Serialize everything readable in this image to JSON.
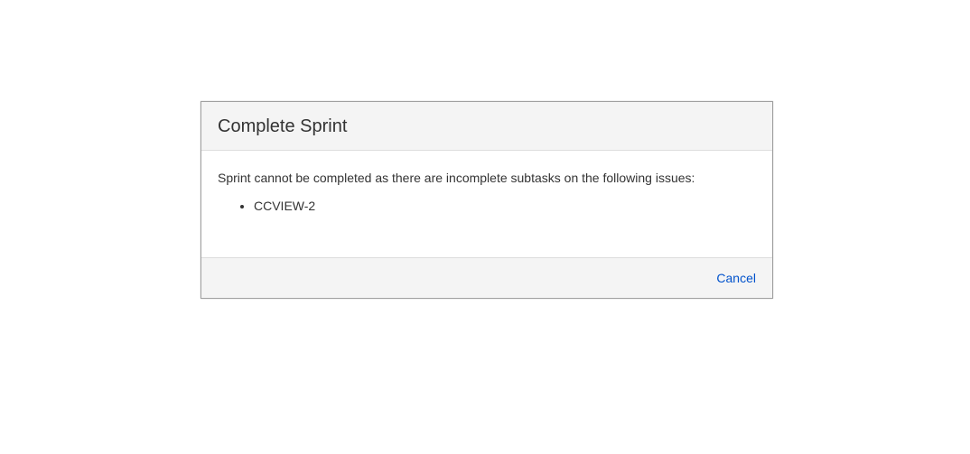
{
  "dialog": {
    "title": "Complete Sprint",
    "message": "Sprint cannot be completed as there are incomplete subtasks on the following issues:",
    "issues": [
      "CCVIEW-2"
    ],
    "cancel_label": "Cancel"
  }
}
